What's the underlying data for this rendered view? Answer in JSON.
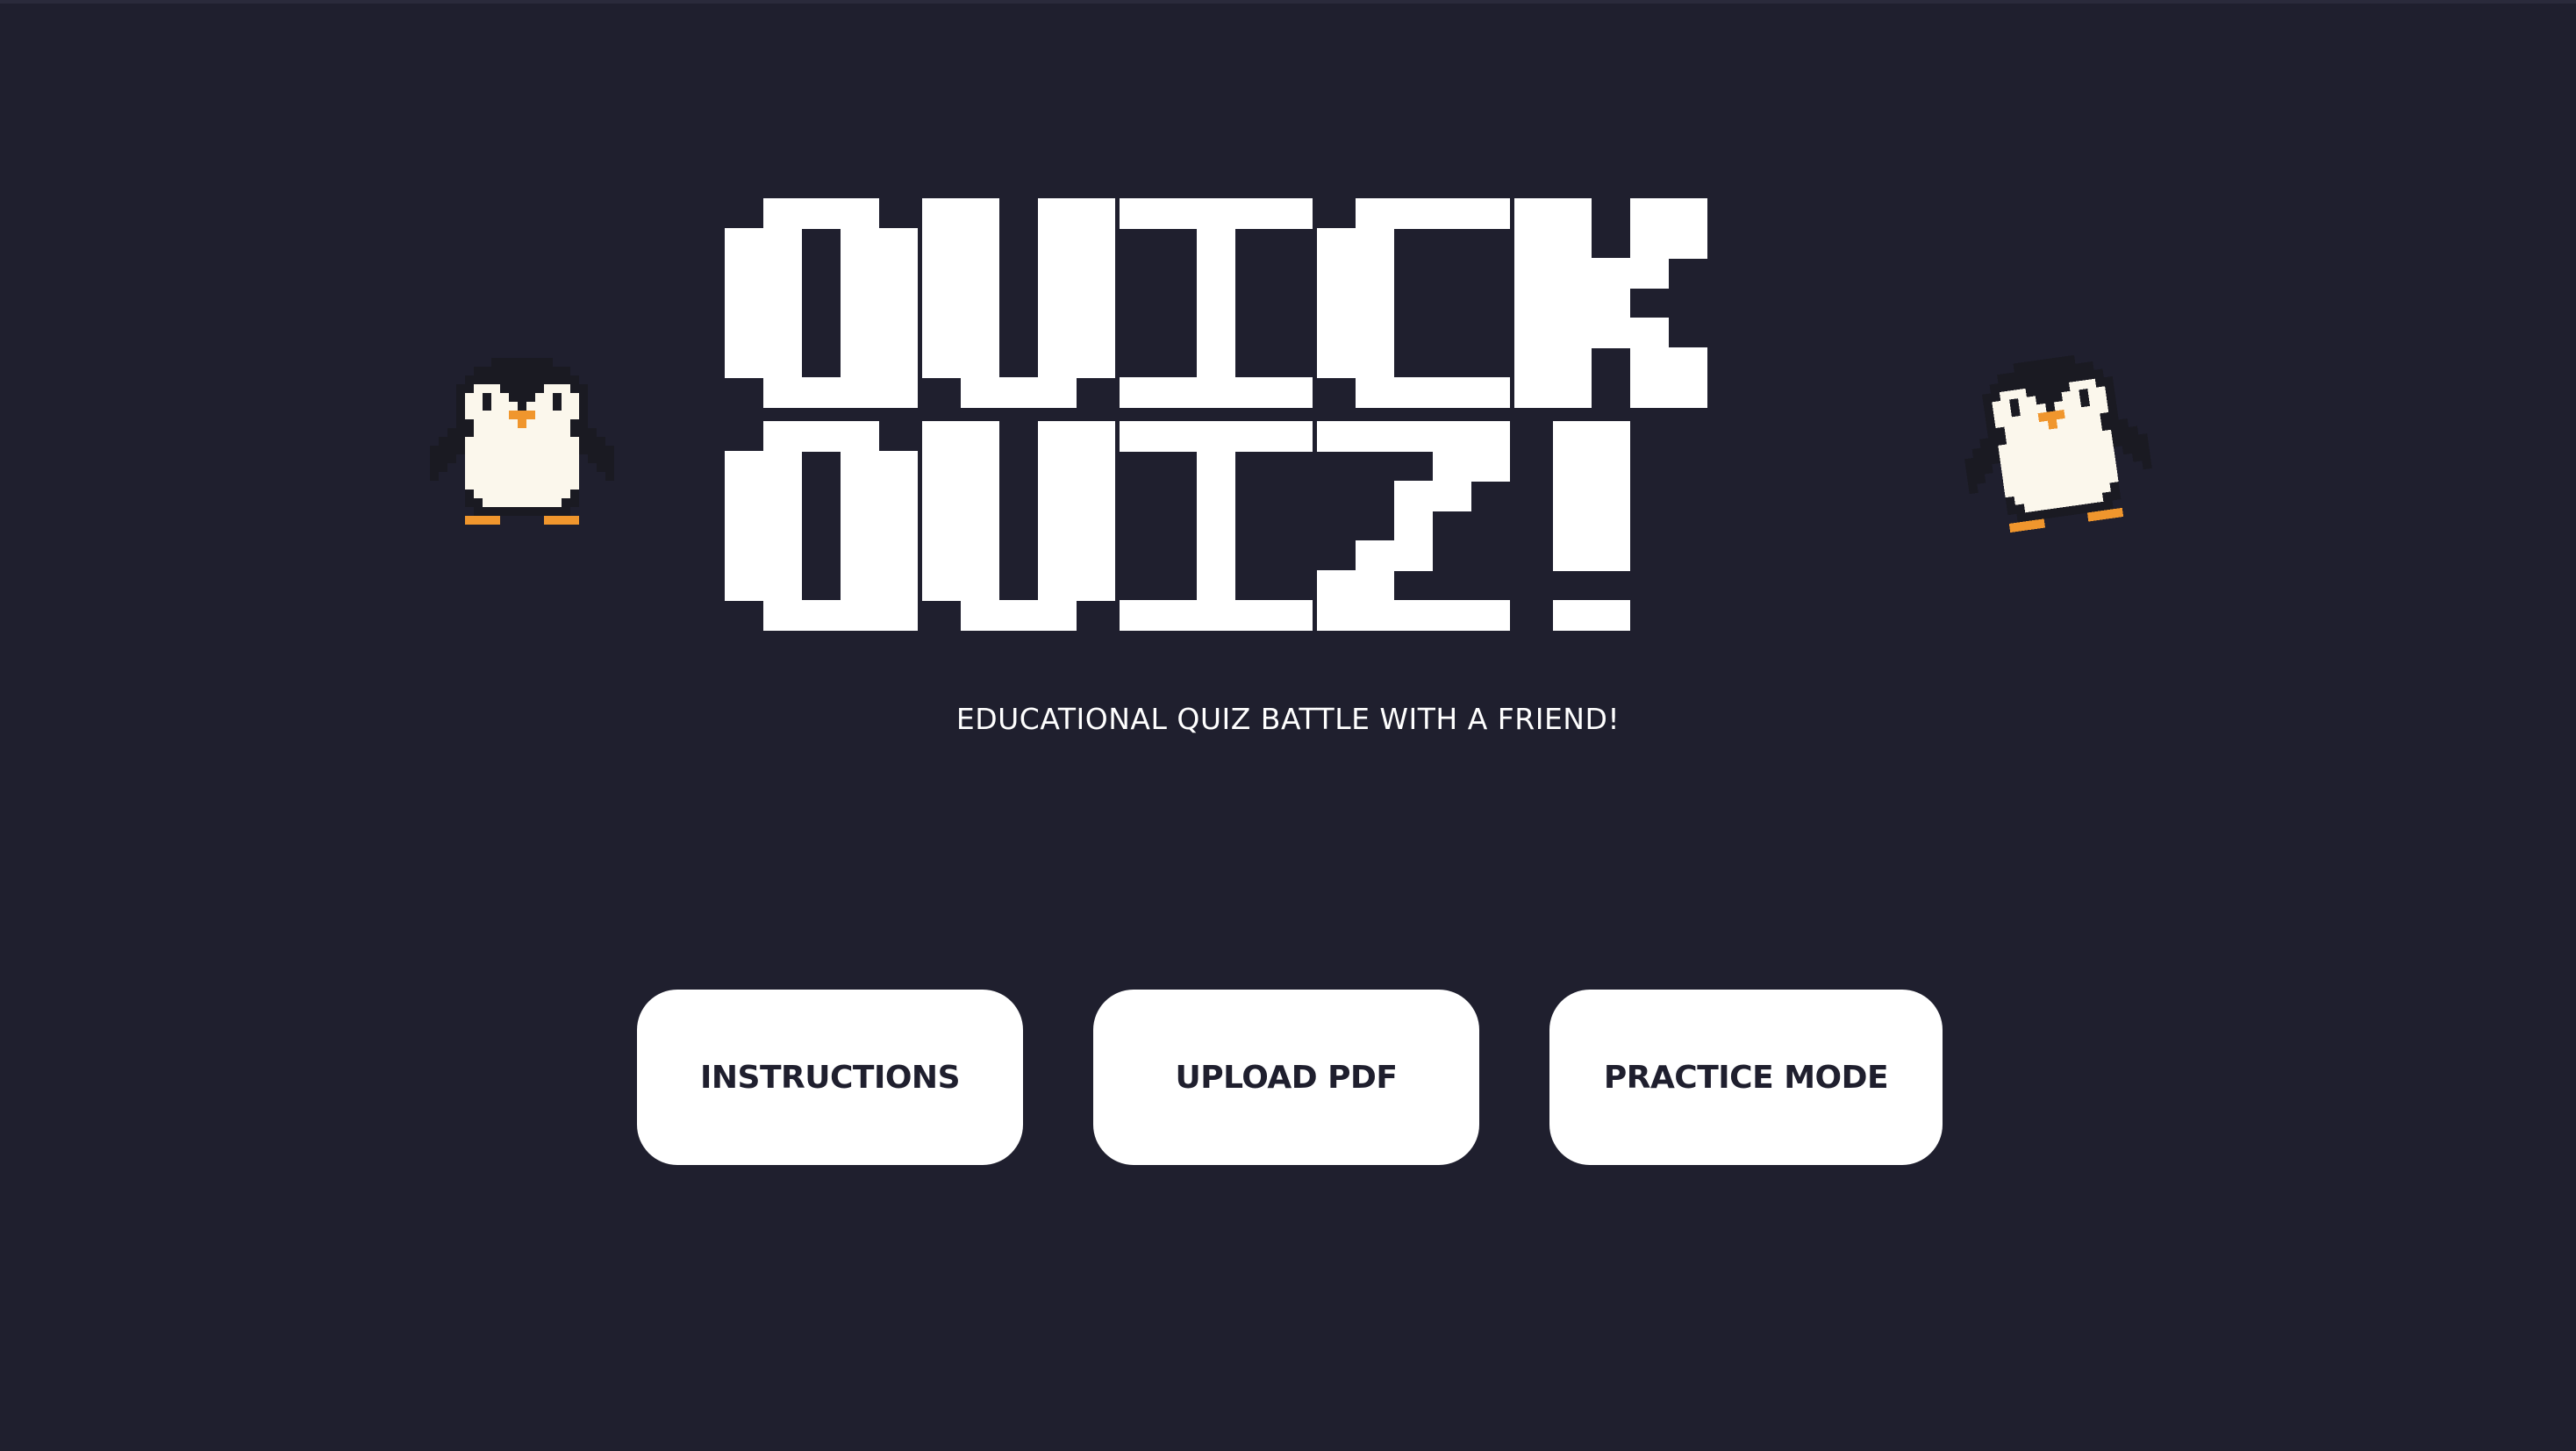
{
  "title": {
    "line1": "QUICK",
    "line2": "QUIZ!"
  },
  "subtitle": "EDUCATIONAL QUIZ BATTLE WITH A FRIEND!",
  "buttons": {
    "instructions": "INSTRUCTIONS",
    "upload_pdf": "UPLOAD PDF",
    "practice_mode": "PRACTICE MODE"
  },
  "mascots": [
    "penguin-icon",
    "penguin-icon"
  ],
  "colors": {
    "background": "#1f1f2e",
    "text": "#ffffff",
    "button_bg": "#ffffff",
    "button_text": "#1f1f2e",
    "penguin_beak": "#f0962d",
    "penguin_body": "#1a1a22",
    "penguin_belly": "#fbf7ec"
  }
}
